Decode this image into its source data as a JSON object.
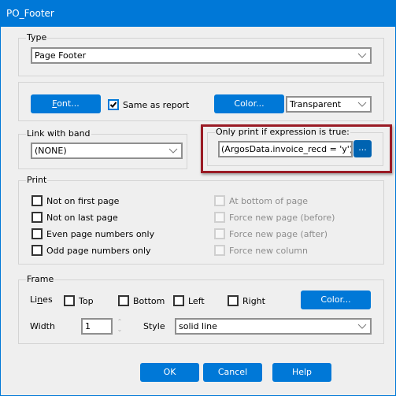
{
  "window": {
    "title": "PO_Footer"
  },
  "type_group": {
    "label": "Type",
    "select_value": "Page Footer"
  },
  "appearance": {
    "font_button": {
      "label_prefix": "",
      "accel": "F",
      "label_rest": "ont..."
    },
    "same_as_report": {
      "label": "Same as report",
      "checked": true
    },
    "color_button": "Color...",
    "color_select": "Transparent"
  },
  "link_band": {
    "label": "Link with band",
    "select_value": "(NONE)"
  },
  "expression": {
    "label": "Only print if expression is true:",
    "value": "(ArgosData.invoice_recd = 'y') and",
    "ellipsis_button": "..."
  },
  "print_group": {
    "label": "Print",
    "left_options": [
      {
        "label": "Not on first page",
        "checked": false
      },
      {
        "label": "Not on last page",
        "checked": false
      },
      {
        "label": "Even page numbers only",
        "checked": false
      },
      {
        "label": "Odd page numbers only",
        "checked": false
      }
    ],
    "right_options": [
      {
        "label": "At bottom of page",
        "checked": false,
        "disabled": true
      },
      {
        "label": "Force new page (before)",
        "checked": false,
        "disabled": true
      },
      {
        "label": "Force new page (after)",
        "checked": false,
        "disabled": true
      },
      {
        "label": "Force new column",
        "checked": false,
        "disabled": true
      }
    ]
  },
  "frame_group": {
    "label": "Frame",
    "lines_label_pre": "Li",
    "lines_label_accel": "n",
    "lines_label_post": "es",
    "lines": [
      {
        "label": "Top",
        "checked": false
      },
      {
        "label": "Bottom",
        "checked": false
      },
      {
        "label": "Left",
        "checked": false
      },
      {
        "label": "Right",
        "checked": false
      }
    ],
    "color_button": "Color...",
    "width_label": "Width",
    "width_value": "1",
    "style_label": "Style",
    "style_value": "solid line"
  },
  "footer_buttons": {
    "ok": "OK",
    "cancel": "Cancel",
    "help": "Help"
  },
  "colors": {
    "accent": "#0078d7",
    "highlight_border": "#9a1b25"
  }
}
